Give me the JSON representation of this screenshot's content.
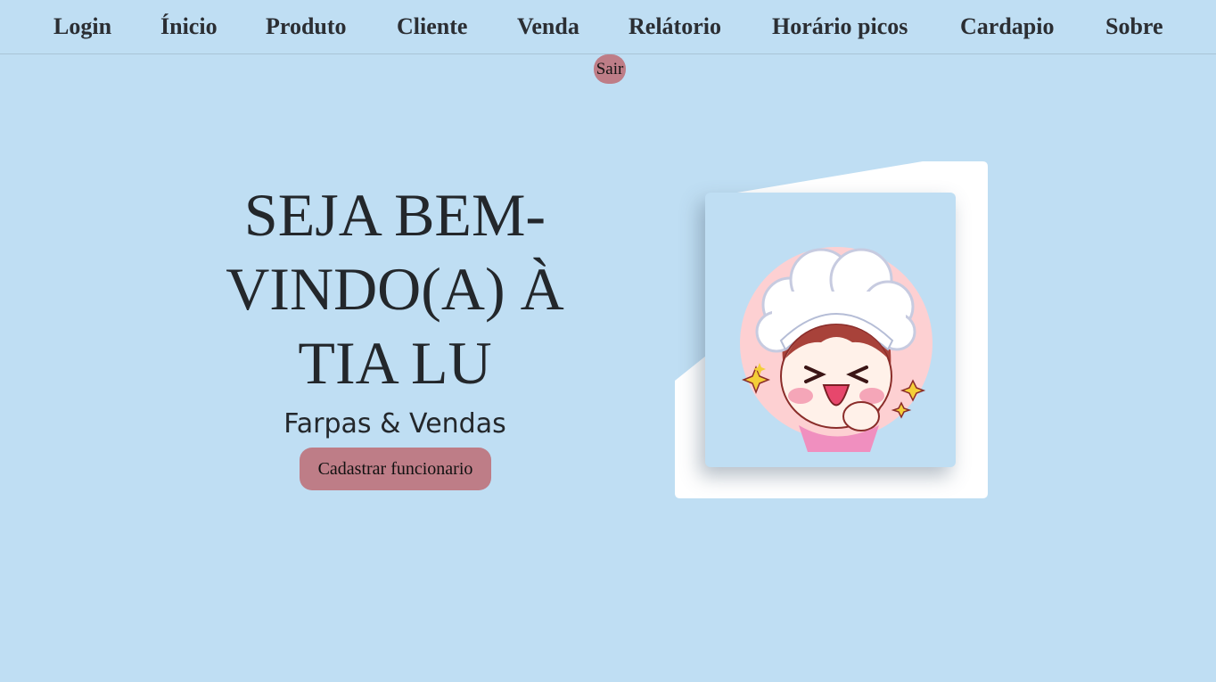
{
  "nav": {
    "items": [
      "Login",
      "Ínicio",
      "Produto",
      "Cliente",
      "Venda",
      "Relátorio",
      "Horário picos",
      "Cardapio",
      "Sobre"
    ],
    "logout_label": "Sair"
  },
  "hero": {
    "title": "SEJA BEM-VINDO(A) À TIA LU",
    "subtitle": "Farpas & Vendas",
    "cta_label": "Cadastrar funcionario"
  },
  "colors": {
    "background": "#bfdef3",
    "button": "#be7d87",
    "text": "#23272b"
  },
  "illustration": {
    "icon": "chef-mascot-icon"
  }
}
